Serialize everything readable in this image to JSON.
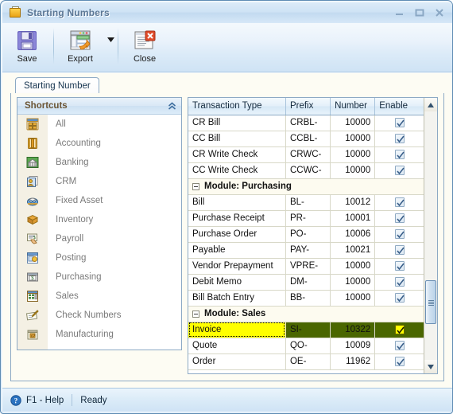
{
  "window": {
    "title": "Starting Numbers",
    "icon": "folder-document-icon",
    "minimize_label": "–",
    "maximize_label": "□",
    "close_label": "✕"
  },
  "toolbar": {
    "items": [
      {
        "label": "Save",
        "icon": "floppy-disk-icon"
      },
      {
        "label": "Export",
        "icon": "spreadsheet-export-icon",
        "has_dropdown": true,
        "dropdown_icon": "caret-down-icon"
      },
      {
        "label": "Close",
        "icon": "document-close-icon"
      }
    ]
  },
  "tabs": [
    {
      "label": "Starting Number",
      "active": true
    }
  ],
  "sidebar": {
    "header": "Shortcuts",
    "collapse_icon": "chevron-double-up-icon",
    "items": [
      {
        "label": "All",
        "icon": "grid-squares-icon"
      },
      {
        "label": "Accounting",
        "icon": "book-icon"
      },
      {
        "label": "Banking",
        "icon": "bank-building-icon"
      },
      {
        "label": "CRM",
        "icon": "contact-card-icon"
      },
      {
        "label": "Fixed Asset",
        "icon": "fixed-asset-icon"
      },
      {
        "label": "Inventory",
        "icon": "box-icon"
      },
      {
        "label": "Payroll",
        "icon": "payroll-hand-icon"
      },
      {
        "label": "Posting",
        "icon": "posting-window-icon"
      },
      {
        "label": "Purchasing",
        "icon": "cash-register-icon"
      },
      {
        "label": "Sales",
        "icon": "calculator-icon"
      },
      {
        "label": "Check Numbers",
        "icon": "check-pen-icon"
      },
      {
        "label": "Manufacturing",
        "icon": "gear-calendar-icon"
      }
    ]
  },
  "grid": {
    "columns": [
      "Transaction Type",
      "Prefix",
      "Number",
      "Enable"
    ],
    "rows": [
      {
        "type": "data",
        "name": "CR Bill",
        "prefix": "CRBL-",
        "number": "10000",
        "enable": true
      },
      {
        "type": "data",
        "name": "CC Bill",
        "prefix": "CCBL-",
        "number": "10000",
        "enable": true
      },
      {
        "type": "data",
        "name": "CR Write Check",
        "prefix": "CRWC-",
        "number": "10000",
        "enable": true
      },
      {
        "type": "data",
        "name": "CC Write Check",
        "prefix": "CCWC-",
        "number": "10000",
        "enable": true
      },
      {
        "type": "group",
        "name": "Module: Purchasing",
        "expanded": true
      },
      {
        "type": "data",
        "name": "Bill",
        "prefix": "BL-",
        "number": "10012",
        "enable": true
      },
      {
        "type": "data",
        "name": "Purchase Receipt",
        "prefix": "PR-",
        "number": "10001",
        "enable": true
      },
      {
        "type": "data",
        "name": "Purchase Order",
        "prefix": "PO-",
        "number": "10006",
        "enable": true
      },
      {
        "type": "data",
        "name": "Payable",
        "prefix": "PAY-",
        "number": "10021",
        "enable": true
      },
      {
        "type": "data",
        "name": "Vendor Prepayment",
        "prefix": "VPRE-",
        "number": "10000",
        "enable": true
      },
      {
        "type": "data",
        "name": "Debit Memo",
        "prefix": "DM-",
        "number": "10000",
        "enable": true
      },
      {
        "type": "data",
        "name": "Bill Batch Entry",
        "prefix": "BB-",
        "number": "10000",
        "enable": true
      },
      {
        "type": "group",
        "name": "Module: Sales",
        "expanded": true
      },
      {
        "type": "data",
        "name": "Invoice",
        "prefix": "SI-",
        "number": "10322",
        "enable": true,
        "selected": true
      },
      {
        "type": "data",
        "name": "Quote",
        "prefix": "QO-",
        "number": "10009",
        "enable": true
      },
      {
        "type": "data",
        "name": "Order",
        "prefix": "OE-",
        "number": "11962",
        "enable": true
      }
    ],
    "scrollbar": {
      "up_icon": "triangle-up-icon",
      "down_icon": "triangle-down-icon"
    }
  },
  "statusbar": {
    "help_icon": "help-circle-icon",
    "help_label": "F1 - Help",
    "status": "Ready"
  },
  "colors": {
    "selection_row": "#4a6600",
    "selection_cell": "#ffff00",
    "accent_border": "#8ca9c4",
    "group_text": "#7b6542"
  }
}
